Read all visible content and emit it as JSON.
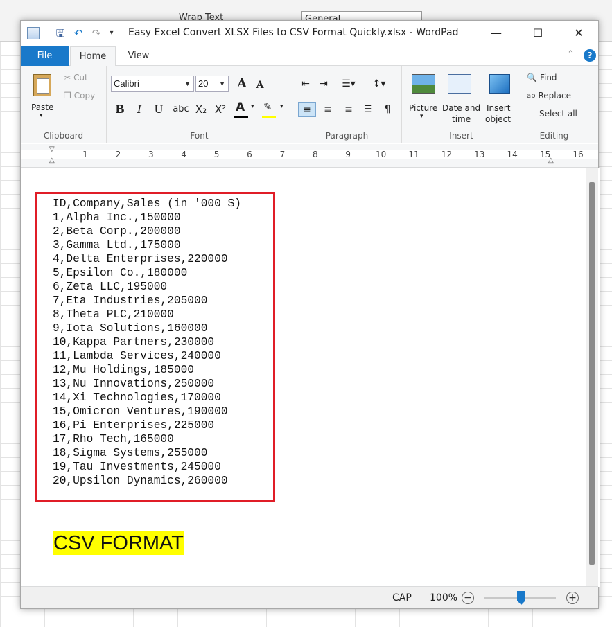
{
  "excel_bg": {
    "wrap_text": "Wrap Text",
    "general": "General"
  },
  "window": {
    "title": "Easy Excel Convert XLSX Files to CSV Format Quickly.xlsx - WordPad",
    "minimize": "—",
    "maximize": "☐",
    "close": "✕"
  },
  "tabs": [
    "File",
    "Home",
    "View"
  ],
  "ribbon": {
    "clipboard": {
      "paste": "Paste",
      "cut": "Cut",
      "copy": "Copy",
      "label": "Clipboard"
    },
    "font": {
      "family": "Calibri",
      "size": "20",
      "label": "Font",
      "bold": "B",
      "italic": "I",
      "underline": "U",
      "strike": "abc",
      "subscript": "X₂",
      "superscript": "X²",
      "color_letter": "A",
      "grow": "A",
      "shrink": "A"
    },
    "paragraph": {
      "label": "Paragraph"
    },
    "insert": {
      "picture": "Picture",
      "datetime_1": "Date and",
      "datetime_2": "time",
      "object_1": "Insert",
      "object_2": "object",
      "label": "Insert"
    },
    "editing": {
      "find": "Find",
      "replace": "Replace",
      "select_all": "Select all",
      "label": "Editing"
    }
  },
  "ruler": {
    "numbers": [
      "1",
      "2",
      "3",
      "4",
      "5",
      "6",
      "7",
      "8",
      "9",
      "10",
      "11",
      "12",
      "13",
      "14",
      "15",
      "16"
    ]
  },
  "document": {
    "csv_lines": [
      "ID,Company,Sales (in '000 $)",
      "1,Alpha Inc.,150000",
      "2,Beta Corp.,200000",
      "3,Gamma Ltd.,175000",
      "4,Delta Enterprises,220000",
      "5,Epsilon Co.,180000",
      "6,Zeta LLC,195000",
      "7,Eta Industries,205000",
      "8,Theta PLC,210000",
      "9,Iota Solutions,160000",
      "10,Kappa Partners,230000",
      "11,Lambda Services,240000",
      "12,Mu Holdings,185000",
      "13,Nu Innovations,250000",
      "14,Xi Technologies,170000",
      "15,Omicron Ventures,190000",
      "16,Pi Enterprises,225000",
      "17,Rho Tech,165000",
      "18,Sigma Systems,255000",
      "19,Tau Investments,245000",
      "20,Upsilon Dynamics,260000"
    ],
    "heading": "CSV FORMAT"
  },
  "status": {
    "caps": "CAP",
    "zoom": "100%",
    "zoom_value_percent": 100
  },
  "colors": {
    "accent": "#1979ca",
    "highlight": "#ffff00",
    "box_border": "#e01d27"
  }
}
